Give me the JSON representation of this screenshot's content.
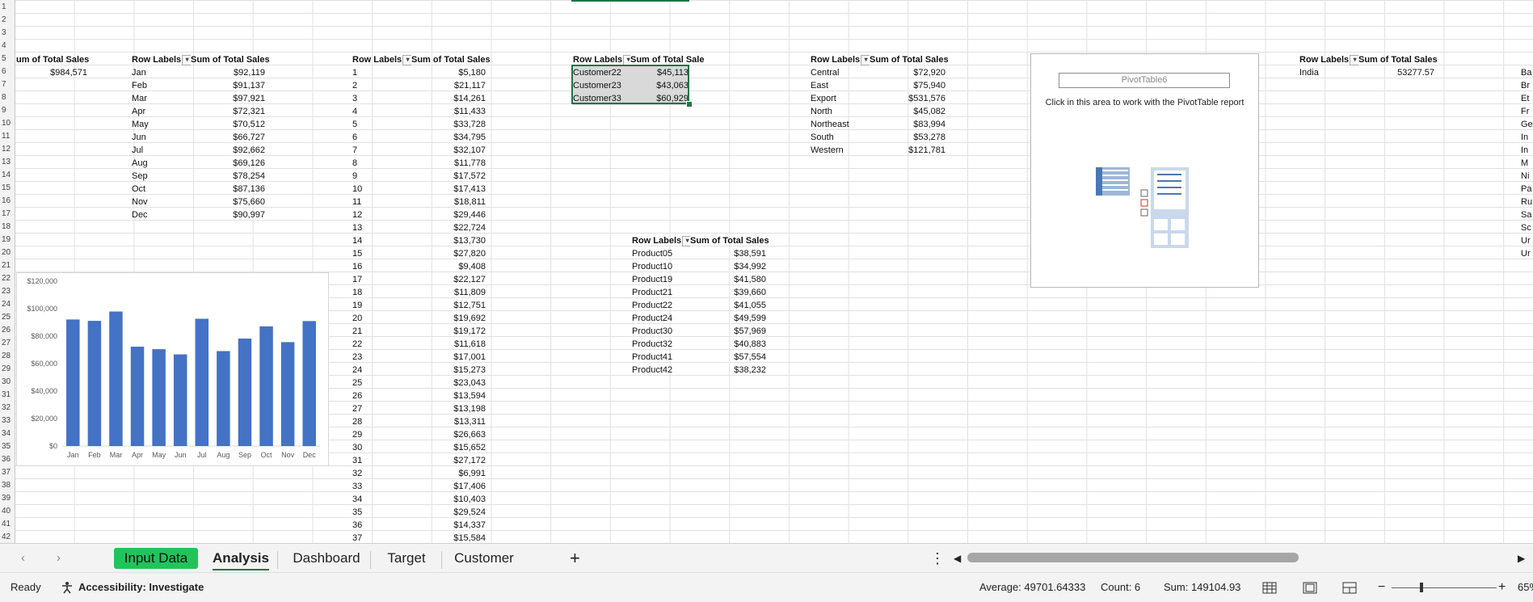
{
  "row_numbers": [
    "1",
    "2",
    "3",
    "4",
    "5",
    "6",
    "7",
    "8",
    "9",
    "10",
    "11",
    "12",
    "13",
    "14",
    "15",
    "16",
    "17",
    "18",
    "19",
    "20",
    "21",
    "22",
    "23",
    "24",
    "25",
    "26",
    "27",
    "28",
    "29",
    "30",
    "31",
    "32",
    "33",
    "34",
    "35",
    "36",
    "37",
    "38",
    "39",
    "40",
    "41",
    "42"
  ],
  "pivot_a": {
    "header": "um of Total Sales",
    "value": "$984,571"
  },
  "pivot_months": {
    "col1": "Row Labels",
    "col2": "Sum of Total Sales",
    "rows": [
      [
        "Jan",
        "$92,119"
      ],
      [
        "Feb",
        "$91,137"
      ],
      [
        "Mar",
        "$97,921"
      ],
      [
        "Apr",
        "$72,321"
      ],
      [
        "May",
        "$70,512"
      ],
      [
        "Jun",
        "$66,727"
      ],
      [
        "Jul",
        "$92,662"
      ],
      [
        "Aug",
        "$69,126"
      ],
      [
        "Sep",
        "$78,254"
      ],
      [
        "Oct",
        "$87,136"
      ],
      [
        "Nov",
        "$75,660"
      ],
      [
        "Dec",
        "$90,997"
      ]
    ]
  },
  "pivot_days": {
    "col1": "Row Labels",
    "col2": "Sum of Total Sales",
    "rows": [
      [
        "1",
        "$5,180"
      ],
      [
        "2",
        "$21,117"
      ],
      [
        "3",
        "$14,261"
      ],
      [
        "4",
        "$11,433"
      ],
      [
        "5",
        "$33,728"
      ],
      [
        "6",
        "$34,795"
      ],
      [
        "7",
        "$32,107"
      ],
      [
        "8",
        "$11,778"
      ],
      [
        "9",
        "$17,572"
      ],
      [
        "10",
        "$17,413"
      ],
      [
        "11",
        "$18,811"
      ],
      [
        "12",
        "$29,446"
      ],
      [
        "13",
        "$22,724"
      ],
      [
        "14",
        "$13,730"
      ],
      [
        "15",
        "$27,820"
      ],
      [
        "16",
        "$9,408"
      ],
      [
        "17",
        "$22,127"
      ],
      [
        "18",
        "$11,809"
      ],
      [
        "19",
        "$12,751"
      ],
      [
        "20",
        "$19,692"
      ],
      [
        "21",
        "$19,172"
      ],
      [
        "22",
        "$11,618"
      ],
      [
        "23",
        "$17,001"
      ],
      [
        "24",
        "$15,273"
      ],
      [
        "25",
        "$23,043"
      ],
      [
        "26",
        "$13,594"
      ],
      [
        "27",
        "$13,198"
      ],
      [
        "28",
        "$13,311"
      ],
      [
        "29",
        "$26,663"
      ],
      [
        "30",
        "$15,652"
      ],
      [
        "31",
        "$27,172"
      ],
      [
        "32",
        "$6,991"
      ],
      [
        "33",
        "$17,406"
      ],
      [
        "34",
        "$10,403"
      ],
      [
        "35",
        "$29,524"
      ],
      [
        "36",
        "$14,337"
      ],
      [
        "37",
        "$15,584"
      ]
    ]
  },
  "pivot_customers": {
    "col1": "Row Labels",
    "col2": "Sum of Total Sales",
    "rows": [
      [
        "Customer22",
        "$45,113"
      ],
      [
        "Customer23",
        "$43,063"
      ],
      [
        "Customer33",
        "$60,929"
      ]
    ]
  },
  "pivot_products": {
    "col1": "Row Labels",
    "col2": "Sum of Total Sales",
    "rows": [
      [
        "Product05",
        "$38,591"
      ],
      [
        "Product10",
        "$34,992"
      ],
      [
        "Product19",
        "$41,580"
      ],
      [
        "Product21",
        "$39,660"
      ],
      [
        "Product22",
        "$41,055"
      ],
      [
        "Product24",
        "$49,599"
      ],
      [
        "Product30",
        "$57,969"
      ],
      [
        "Product32",
        "$40,883"
      ],
      [
        "Product41",
        "$57,554"
      ],
      [
        "Product42",
        "$38,232"
      ]
    ]
  },
  "pivot_regions": {
    "col1": "Row Labels",
    "col2": "Sum of Total Sales",
    "rows": [
      [
        "Central",
        "$72,920"
      ],
      [
        "East",
        "$75,940"
      ],
      [
        "Export",
        "$531,576"
      ],
      [
        "North",
        "$45,082"
      ],
      [
        "Northeast",
        "$83,994"
      ],
      [
        "South",
        "$53,278"
      ],
      [
        "Western",
        "$121,781"
      ]
    ]
  },
  "pivot6": {
    "name": "PivotTable6",
    "message": "Click in this area to work with the PivotTable report"
  },
  "pivot_country": {
    "col1": "Row Labels",
    "col2": "Sum of Total Sales",
    "rows": [
      [
        "India",
        "53277.57"
      ]
    ]
  },
  "edge_column": [
    "Ba",
    "Br",
    "Et",
    "Fr",
    "Ge",
    "In",
    "In",
    "M",
    "Ni",
    "Pa",
    "Ru",
    "Sa",
    "Sc",
    "Ur",
    "Ur"
  ],
  "chart_data": {
    "type": "bar",
    "categories": [
      "Jan",
      "Feb",
      "Mar",
      "Apr",
      "May",
      "Jun",
      "Jul",
      "Aug",
      "Sep",
      "Oct",
      "Nov",
      "Dec"
    ],
    "values": [
      92119,
      91137,
      97921,
      72321,
      70512,
      66727,
      92662,
      69126,
      78254,
      87136,
      75660,
      90997
    ],
    "ylim": [
      0,
      120000
    ],
    "yticks": [
      0,
      20000,
      40000,
      60000,
      80000,
      100000,
      120000
    ],
    "ytick_labels": [
      "$0",
      "$20,000",
      "$40,000",
      "$60,000",
      "$80,000",
      "$100,000",
      "$120,000"
    ],
    "color": "#4472c4",
    "grid": false,
    "title": "",
    "xlabel": "",
    "ylabel": ""
  },
  "sheet_tabs": [
    "Input Data",
    "Analysis",
    "Dashboard",
    "Target",
    "Customer"
  ],
  "active_tab": "Analysis",
  "input_tab_color": "#21c45a",
  "status": {
    "ready": "Ready",
    "accessibility": "Accessibility: Investigate",
    "average": "Average: 49701.64333",
    "count": "Count: 6",
    "sum": "Sum: 149104.93",
    "zoom": "65%"
  }
}
